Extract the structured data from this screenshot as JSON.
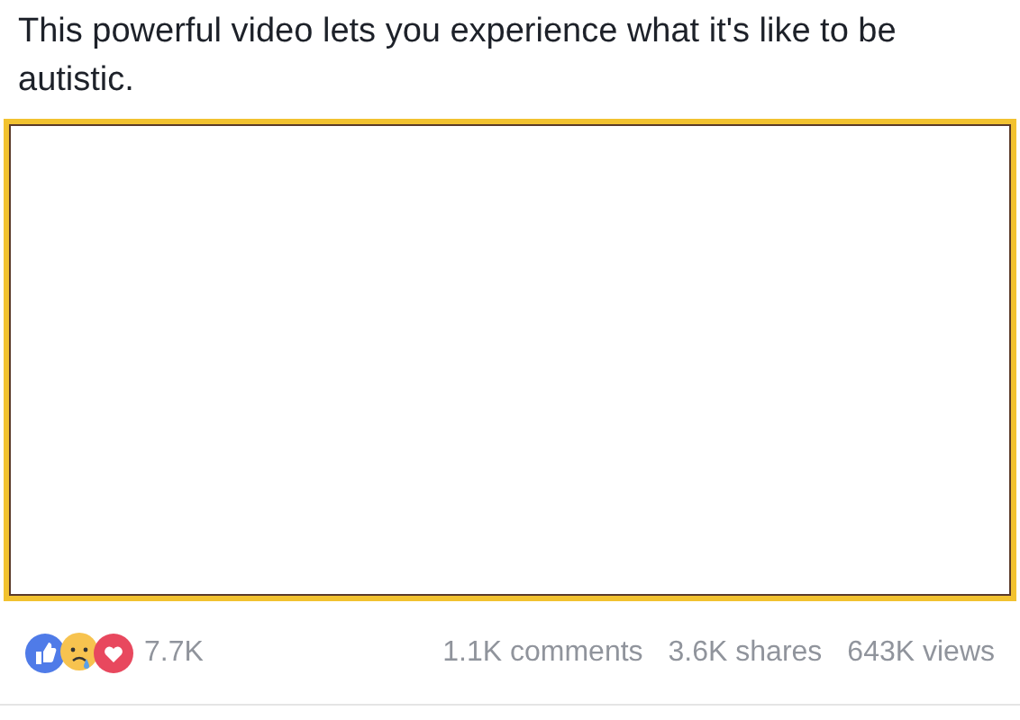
{
  "post": {
    "text": "This powerful video lets you experience what it's like to be autistic."
  },
  "stats": {
    "reactions_count": "7.7K",
    "comments": "1.1K comments",
    "shares": "3.6K shares",
    "views": "643K views"
  }
}
